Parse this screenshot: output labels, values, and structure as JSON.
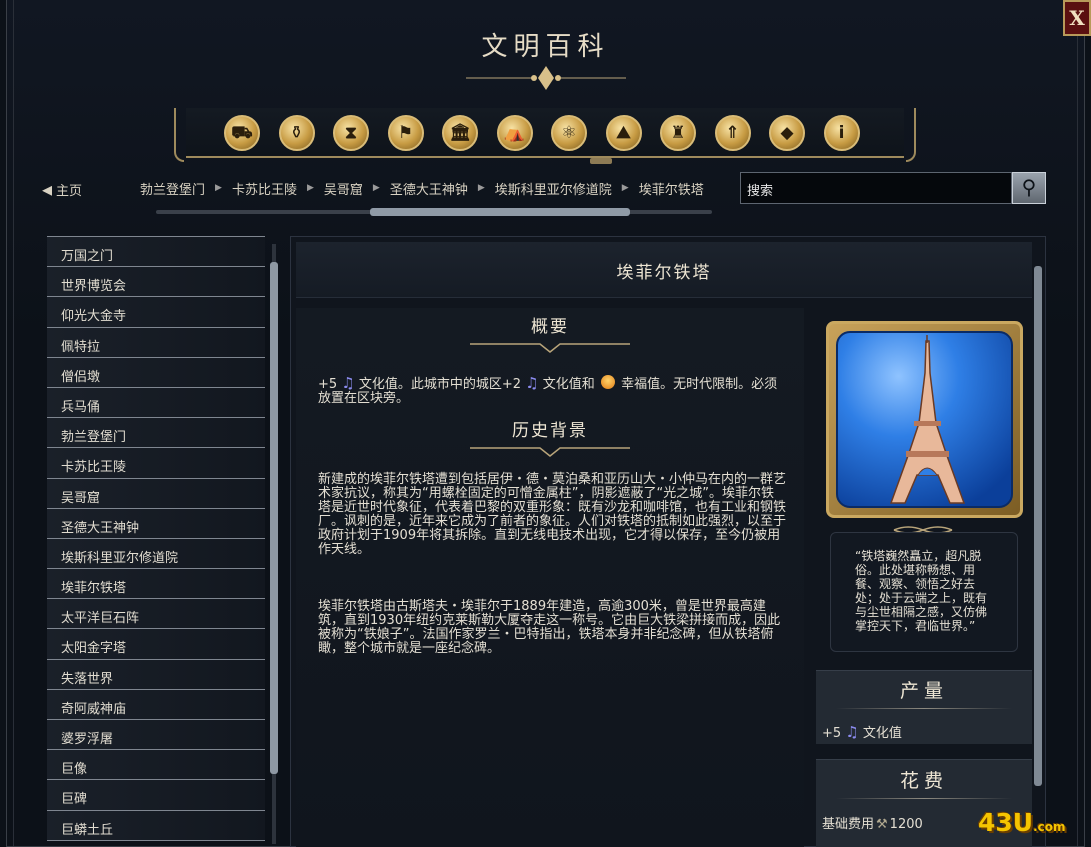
{
  "window": {
    "title": "文明百科",
    "close_label": "X"
  },
  "category_icons": [
    {
      "name": "units-icon",
      "glyph": "⛟"
    },
    {
      "name": "buildings-icon",
      "glyph": "⚱"
    },
    {
      "name": "wonders-icon",
      "glyph": "⧗"
    },
    {
      "name": "districts-icon",
      "glyph": "⚑"
    },
    {
      "name": "government-icon",
      "glyph": "🏛"
    },
    {
      "name": "religion-icon",
      "glyph": "⛺"
    },
    {
      "name": "technology-icon",
      "glyph": "⚛"
    },
    {
      "name": "terrain-icon",
      "glyph": "⛰"
    },
    {
      "name": "city-states-icon",
      "glyph": "♜"
    },
    {
      "name": "improvements-icon",
      "glyph": "⇑"
    },
    {
      "name": "resources-icon",
      "glyph": "◆"
    },
    {
      "name": "info-icon",
      "glyph": "i"
    }
  ],
  "nav": {
    "home_label": "主页",
    "breadcrumbs": [
      "勃兰登堡门",
      "卡苏比王陵",
      "吴哥窟",
      "圣德大王神钟",
      "埃斯科里亚尔修道院",
      "埃菲尔铁塔"
    ],
    "search_placeholder": "搜索"
  },
  "sidebar": {
    "items": [
      "万国之门",
      "世界博览会",
      "仰光大金寺",
      "佩特拉",
      "僧侣墩",
      "兵马俑",
      "勃兰登堡门",
      "卡苏比王陵",
      "吴哥窟",
      "圣德大王神钟",
      "埃斯科里亚尔修道院",
      "埃菲尔铁塔",
      "太平洋巨石阵",
      "太阳金字塔",
      "失落世界",
      "奇阿威神庙",
      "婆罗浮屠",
      "巨像",
      "巨碑",
      "巨蟒土丘"
    ]
  },
  "article": {
    "title": "埃菲尔铁塔",
    "summary_heading": "概要",
    "summary": {
      "part1": "+5",
      "part2": " 文化值。此城市中的城区+2",
      "part3": " 文化值和",
      "part4": " 幸福值。无时代限制。必须放置在区块旁。"
    },
    "history_heading": "历史背景",
    "history_p1": "新建成的埃菲尔铁塔遭到包括居伊・德・莫泊桑和亚历山大・小仲马在内的一群艺术家抗议，称其为“用螺栓固定的可憎金属柱”，阴影遮蔽了“光之城”。埃菲尔铁塔是近世时代象征，代表着巴黎的双重形象：既有沙龙和咖啡馆，也有工业和钢铁厂。讽刺的是，近年来它成为了前者的象征。人们对铁塔的抵制如此强烈，以至于政府计划于1909年将其拆除。直到无线电技术出现，它才得以保存，至今仍被用作天线。",
    "history_p2": "埃菲尔铁塔由古斯塔夫・埃菲尔于1889年建造，高逾300米，曾是世界最高建筑，直到1930年纽约克莱斯勒大厦夺走这一称号。它由巨大铁梁拼接而成，因此被称为“铁娘子”。法国作家罗兰・巴特指出，铁塔本身并非纪念碑，但从铁塔俯瞰，整个城市就是一座纪念碑。",
    "quote": "“铁塔巍然矗立，超凡脱俗。此处堪称畅想、用餐、观察、领悟之好去处；处于云端之上，既有与尘世相隔之感，又仿佛掌控天下，君临世界。”"
  },
  "yield": {
    "heading": "产量",
    "value": "+5",
    "label": "文化值"
  },
  "cost": {
    "heading": "花费",
    "label": "基础费用",
    "value": "1200"
  },
  "watermark": {
    "main": "43U",
    "suffix": ".com"
  },
  "colors": {
    "accent_gold": "#caa860",
    "culture_icon": "#8c8cf0",
    "close_red": "#5a1010"
  }
}
